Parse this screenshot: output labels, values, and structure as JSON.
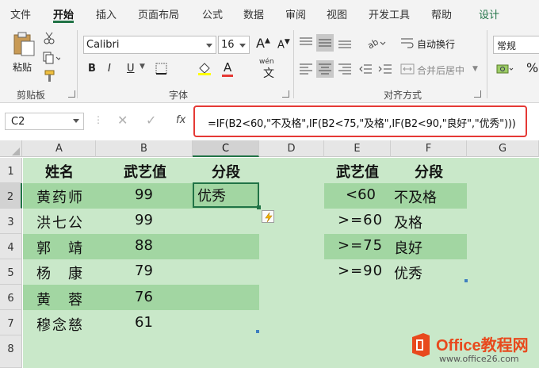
{
  "ribbon_tabs": [
    "文件",
    "开始",
    "插入",
    "页面布局",
    "公式",
    "数据",
    "审阅",
    "视图",
    "开发工具",
    "帮助",
    "设计"
  ],
  "ribbon": {
    "clipboard": {
      "paste_label": "粘贴",
      "group_label": "剪贴板"
    },
    "font": {
      "font_name": "Calibri",
      "font_size": "16",
      "bold": "B",
      "italic": "I",
      "underline": "U",
      "phonetic": "wén",
      "group_label": "字体"
    },
    "alignment": {
      "wrap_text": "自动换行",
      "merge_center": "合并后居中",
      "group_label": "对齐方式"
    },
    "number": {
      "format": "常规",
      "percent": "%"
    }
  },
  "formula_bar": {
    "name_box": "C2",
    "fx": "fx",
    "formula": "=IF(B2<60,\"不及格\",IF(B2<75,\"及格\",IF(B2<90,\"良好\",\"优秀\")))"
  },
  "columns": [
    "A",
    "B",
    "C",
    "D",
    "E",
    "F",
    "G"
  ],
  "rows": [
    "1",
    "2",
    "3",
    "4",
    "5",
    "6",
    "7",
    "8"
  ],
  "table_main": {
    "headers": [
      "姓名",
      "武艺值",
      "分段"
    ],
    "rows": [
      [
        "黄药师",
        "99",
        "优秀"
      ],
      [
        "洪七公",
        "99",
        ""
      ],
      [
        "郭　靖",
        "88",
        ""
      ],
      [
        "杨　康",
        "79",
        ""
      ],
      [
        "黄　蓉",
        "76",
        ""
      ],
      [
        "穆念慈",
        "61",
        ""
      ]
    ]
  },
  "table_lookup": {
    "headers": [
      "武艺值",
      "分段"
    ],
    "rows": [
      [
        "<60",
        "不及格"
      ],
      [
        ">=60",
        "及格"
      ],
      [
        ">=75",
        "良好"
      ],
      [
        ">=90",
        "优秀"
      ]
    ]
  },
  "watermark": {
    "line1": "Office教程网",
    "line2": "www.office26.com"
  },
  "colors": {
    "accent": "#217346",
    "band_dark": "#a2d6a2",
    "band_light": "#c9e8c9",
    "highlight": "#e53935"
  }
}
